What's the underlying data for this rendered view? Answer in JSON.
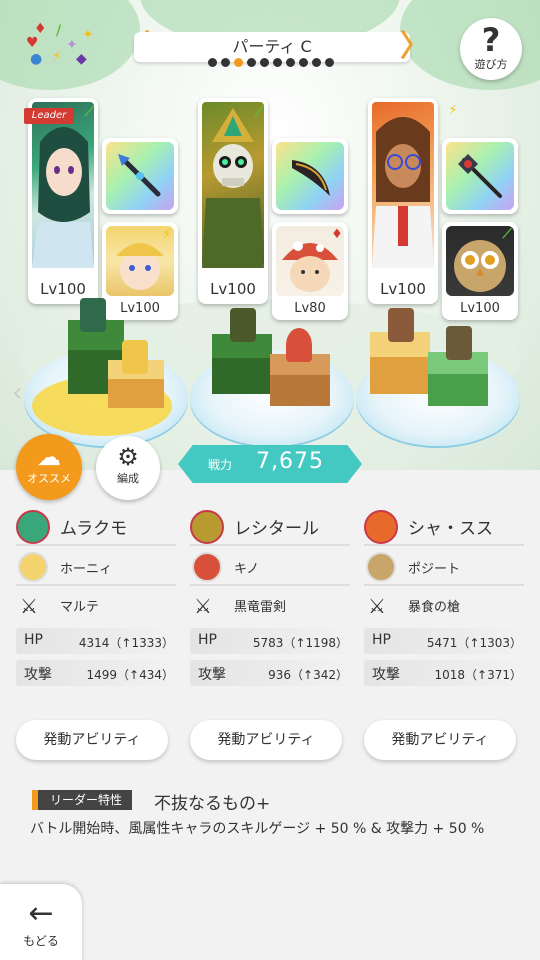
{
  "header": {
    "party_name": "パーティ C",
    "prev_arrow": "〈",
    "next_arrow": "〉",
    "page_count": 10,
    "active_page": 3,
    "help_label": "遊び方"
  },
  "element_icons": [
    "♦",
    "♥",
    "/",
    "●",
    "⚡",
    "◆",
    "✦",
    "✦"
  ],
  "leader_tag": "Leader",
  "party": [
    {
      "main": {
        "name": "ムラクモ",
        "level": "Lv100",
        "attribute": "wind-leaf",
        "is_leader": true
      },
      "sub": {
        "name": "ホーニィ",
        "level": "Lv100",
        "attribute": "lightning"
      },
      "weapon": {
        "name": "マルテ",
        "icon": "spear-icon"
      },
      "stats": {
        "hp_label": "HP",
        "hp": "4314（↑1333）",
        "atk_label": "攻撃",
        "atk": "1499（↑434）"
      },
      "ability_label": "発動アビリティ"
    },
    {
      "main": {
        "name": "レシタール",
        "level": "Lv100",
        "attribute": "wind-leaf",
        "is_leader": false
      },
      "sub": {
        "name": "キノ",
        "level": "Lv80",
        "attribute": "diamond"
      },
      "weapon": {
        "name": "黒竜雷剣",
        "icon": "sword-icon"
      },
      "stats": {
        "hp_label": "HP",
        "hp": "5783（↑1198）",
        "atk_label": "攻撃",
        "atk": "936（↑342）"
      },
      "ability_label": "発動アビリティ"
    },
    {
      "main": {
        "name": "シャ・スス",
        "level": "Lv100",
        "attribute": "lightning",
        "is_leader": false
      },
      "sub": {
        "name": "ポジート",
        "level": "Lv100",
        "attribute": "wind-leaf"
      },
      "weapon": {
        "name": "暴食の槍",
        "icon": "halberd-icon"
      },
      "stats": {
        "hp_label": "HP",
        "hp": "5471（↑1303）",
        "atk_label": "攻撃",
        "atk": "1018（↑371）"
      },
      "ability_label": "発動アビリティ"
    }
  ],
  "power": {
    "label": "戦力",
    "value": "7,675"
  },
  "buttons": {
    "recommend": "オススメ",
    "formation": "編成",
    "back": "もどる"
  },
  "leader_skill": {
    "label": "リーダー特性",
    "name": "不抜なるもの+",
    "description": "バトル開始時、風属性キャラのスキルゲージ + 50 % & 攻撃力 + 50 %"
  },
  "colors": {
    "accent": "#f39a1c",
    "power": "#44c9c2",
    "leader": "#d33a32",
    "wind": "#5cbf3a",
    "lightning": "#f2c21a",
    "diamond": "#d33a32"
  }
}
